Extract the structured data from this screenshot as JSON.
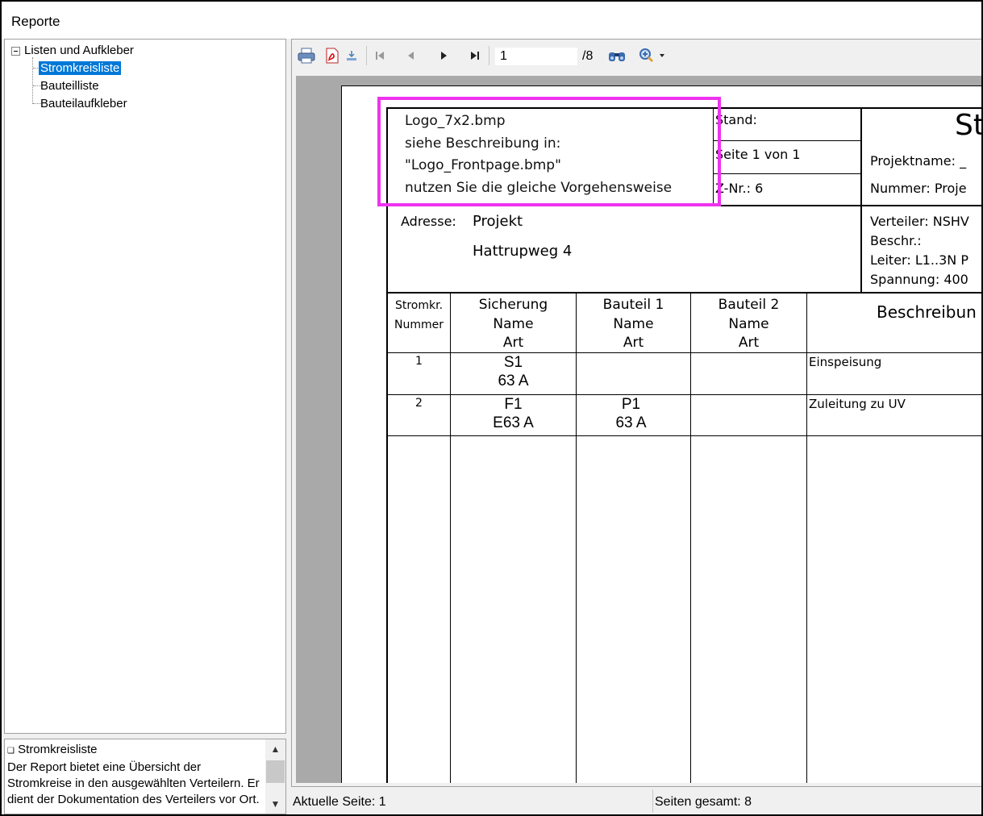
{
  "window": {
    "title": "Reporte"
  },
  "tree": {
    "root_label": "Listen und Aufkleber",
    "items": [
      {
        "label": "Stromkreisliste",
        "selected": true
      },
      {
        "label": "Bauteilliste",
        "selected": false
      },
      {
        "label": "Bauteilaufkleber",
        "selected": false
      }
    ]
  },
  "description": {
    "title": "Stromkreisliste",
    "text": "Der Report bietet eine Übersicht der Stromkreise in den ausgewählten Verteilern. Er dient der Dokumentation des Verteilers vor Ort."
  },
  "toolbar": {
    "icons": [
      "print-icon",
      "export-pdf-icon",
      "export-icon",
      "first-page-icon",
      "prev-page-icon",
      "next-page-icon",
      "last-page-icon",
      "find-icon",
      "zoom-icon"
    ],
    "page_value": "1",
    "page_total": "/8"
  },
  "report": {
    "logo_lines": [
      "Logo_7x2.bmp",
      "siehe Beschreibung in:",
      "\"Logo_Frontpage.bmp\"",
      "nutzen Sie die gleiche Vorgehensweise"
    ],
    "stand_label": "Stand:",
    "seite_label": "Seite 1 von  1",
    "znr_label": "Z-Nr.: 6",
    "title_partial": "St",
    "projektname_label": "Projektname: _",
    "nummer_label": "Nummer: Proje",
    "adresse_label": "Adresse:",
    "adresse_line1": "Projekt",
    "adresse_line2": "Hattrupweg 4",
    "verteiler_label": "Verteiler: NSHV",
    "beschr_label": "Beschr.:",
    "leiter_label": "Leiter: L1..3N P",
    "spannung_label": "Spannung: 400",
    "headers": {
      "col1_line1": "Stromkr.",
      "col1_line2": "Nummer",
      "col2_line1": "Sicherung",
      "col2_line2": "Name",
      "col2_line3": "Art",
      "col3_line1": "Bauteil 1",
      "col3_line2": "Name",
      "col3_line3": "Art",
      "col4_line1": "Bauteil 2",
      "col4_line2": "Name",
      "col4_line3": "Art",
      "col5": "Beschreibun"
    },
    "rows": [
      {
        "nummer": "1",
        "sich_name": "S1",
        "sich_art": "63 A",
        "b1_name": "",
        "b1_art": "",
        "b2_name": "",
        "b2_art": "",
        "beschreibung": "Einspeisung"
      },
      {
        "nummer": "2",
        "sich_name": "F1",
        "sich_art": "E63 A",
        "b1_name": "P1",
        "b1_art": "63 A",
        "b2_name": "",
        "b2_art": "",
        "beschreibung": "Zuleitung zu UV"
      }
    ]
  },
  "status": {
    "current_page": "Aktuelle Seite: 1",
    "total_pages": "Seiten gesamt: 8"
  }
}
